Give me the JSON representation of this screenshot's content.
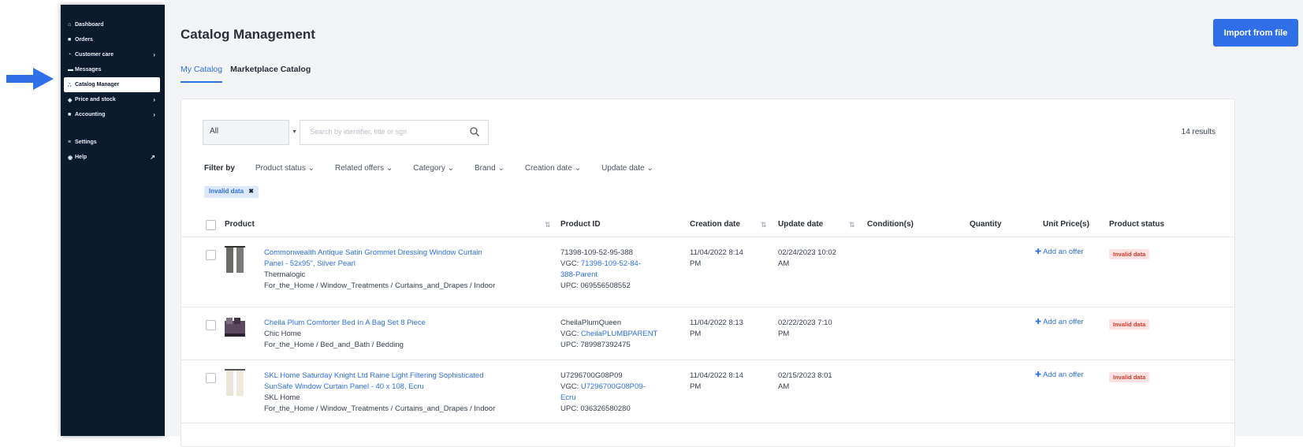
{
  "sidebar": {
    "items": [
      {
        "label": "Dashboard",
        "icon": "home-icon",
        "glyph": "⌂",
        "chevron": false
      },
      {
        "label": "Orders",
        "icon": "orders-icon",
        "glyph": "■",
        "chevron": false
      },
      {
        "label": "Customer care",
        "icon": "customer-care-icon",
        "glyph": "◔",
        "chevron": true
      },
      {
        "label": "Messages",
        "icon": "messages-icon",
        "glyph": "▬",
        "chevron": false
      },
      {
        "label": "Catalog Manager",
        "icon": "catalog-icon",
        "glyph": "∴",
        "chevron": false,
        "active": true
      },
      {
        "label": "Price and stock",
        "icon": "tag-icon",
        "glyph": "◆",
        "chevron": true
      },
      {
        "label": "Accounting",
        "icon": "accounting-icon",
        "glyph": "■",
        "chevron": true
      }
    ],
    "bottom_items": [
      {
        "label": "Settings",
        "icon": "settings-icon",
        "glyph": "≡"
      },
      {
        "label": "Help",
        "icon": "help-icon",
        "glyph": "◉",
        "external": true
      }
    ]
  },
  "header": {
    "title": "Catalog Management",
    "import_label": "Import from file"
  },
  "tabs": [
    {
      "label": "My Catalog",
      "active": true
    },
    {
      "label": "Marketplace Catalog",
      "active": false
    }
  ],
  "search": {
    "select_value": "All",
    "placeholder": "Search by identifier, title or sgn",
    "results": "14 results"
  },
  "filters": {
    "label": "Filter by",
    "items": [
      "Product status",
      "Related offers",
      "Category",
      "Brand",
      "Creation date",
      "Update date"
    ]
  },
  "active_chip": "Invalid data",
  "table": {
    "headers": {
      "product": "Product",
      "product_id": "Product ID",
      "creation_date": "Creation date",
      "update_date": "Update date",
      "conditions": "Condition(s)",
      "quantity": "Quantity",
      "unit_price": "Unit Price(s)",
      "product_status": "Product status"
    },
    "rows": [
      {
        "title_line1": "Commonwealth Antique Satin Grommet Dressing Window Curtain",
        "title_line2": "Panel - 52x95\", Silver Pearl",
        "brand": "Thermalogic",
        "category": "For_the_Home / Window_Treatments / Curtains_and_Drapes / Indoor",
        "id": "71398-109-52-95-388",
        "vgc_label": "VGC:",
        "vgc_line1": "71398-109-52-84-",
        "vgc_line2": "388-Parent",
        "upc": "UPC: 069556508552",
        "creation_line1": "11/04/2022 8:14",
        "creation_line2": "PM",
        "update_line1": "02/24/2023 10:02",
        "update_line2": "AM",
        "offer_label": "Add an offer",
        "status": "Invalid data"
      },
      {
        "title_line1": "Cheila Plum Comforter Bed In A Bag Set 8 Piece",
        "title_line2": "",
        "brand": "Chic Home",
        "category": "For_the_Home / Bed_and_Bath / Bedding",
        "id": "CheilaPlumQueen",
        "vgc_label": "VGC:",
        "vgc_line1": "CheilaPLUMBPARENT",
        "vgc_line2": "",
        "upc": "UPC: 789987392475",
        "creation_line1": "11/04/2022 8:13",
        "creation_line2": "PM",
        "update_line1": "02/22/2023 7:10",
        "update_line2": "PM",
        "offer_label": "Add an offer",
        "status": "Invalid data"
      },
      {
        "title_line1": "SKL Home Saturday Knight Ltd Raine Light Filtering Sophisticated",
        "title_line2": "SunSafe Window Curtain Panel - 40 x 108, Ecru",
        "brand": "SKL Home",
        "category": "For_the_Home / Window_Treatments / Curtains_and_Drapes / Indoor",
        "id": "U7296700G08P09",
        "vgc_label": "VGC:",
        "vgc_line1": "U7296700G08P09-",
        "vgc_line2": "Ecru",
        "upc": "UPC: 036326580280",
        "creation_line1": "11/04/2022 8:14",
        "creation_line2": "PM",
        "update_line1": "02/15/2023 8:01",
        "update_line2": "AM",
        "offer_label": "Add an offer",
        "status": "Invalid data"
      }
    ]
  },
  "colors": {
    "accent": "#2f6fe8",
    "sidebar_bg": "#0c1a2e",
    "invalid_badge_bg": "#fde2e1",
    "invalid_badge_text": "#d33b2f"
  }
}
